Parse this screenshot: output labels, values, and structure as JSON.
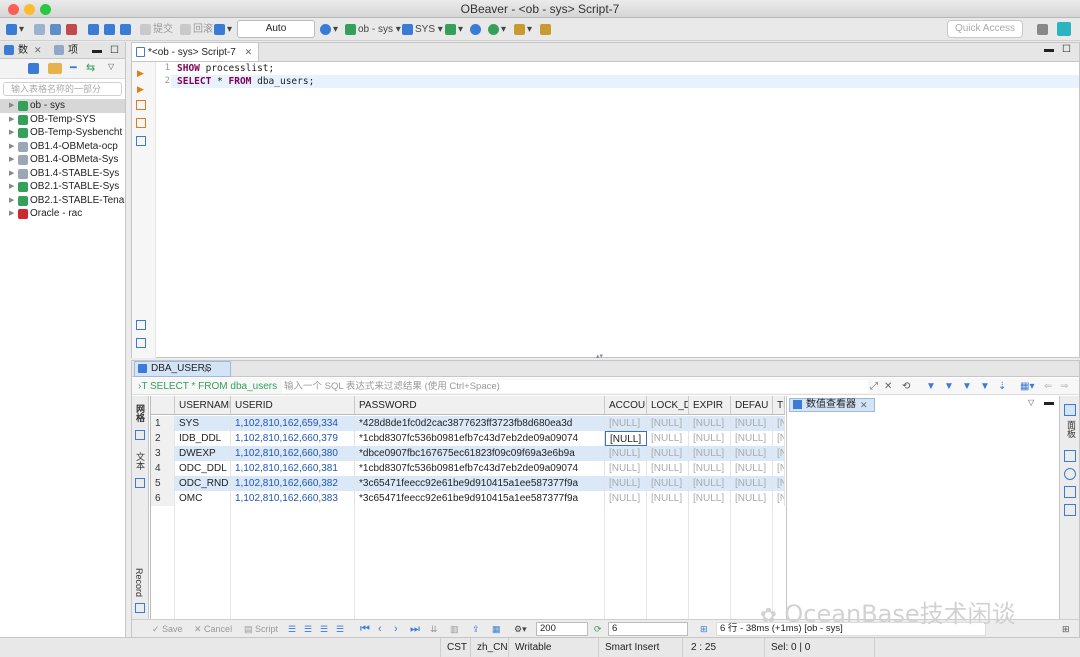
{
  "window": {
    "title": "OBeaver - <ob - sys> Script-7"
  },
  "toolbar": {
    "transaction_mode": "Auto",
    "connection": "ob - sys",
    "schema": "SYS",
    "commit_label": "提交",
    "rollback_label": "回滚",
    "quick_access_placeholder": "Quick Access"
  },
  "navigator": {
    "tab1": "数",
    "tab2": "项",
    "filter_placeholder": "输入表格名称的一部分",
    "items": [
      {
        "label": "ob - sys",
        "color": "#35a05a"
      },
      {
        "label": "OB-Temp-SYS",
        "color": "#35a05a"
      },
      {
        "label": "OB-Temp-Sysbencht",
        "color": "#35a05a"
      },
      {
        "label": "OB1.4-OBMeta-ocp",
        "color": "#9aa7b4"
      },
      {
        "label": "OB1.4-OBMeta-Sys",
        "color": "#9aa7b4"
      },
      {
        "label": "OB1.4-STABLE-Sys",
        "color": "#9aa7b4"
      },
      {
        "label": "OB2.1-STABLE-Sys",
        "color": "#35a05a"
      },
      {
        "label": "OB2.1-STABLE-Tena",
        "color": "#35a05a"
      },
      {
        "label": "Oracle - rac",
        "color": "#d0262d"
      }
    ]
  },
  "editor": {
    "tab_label": "*<ob - sys> Script-7",
    "lines": [
      {
        "num": "1",
        "kw1": "SHOW",
        "rest": " processlist;"
      },
      {
        "num": "2",
        "kw1": "SELECT",
        "mid": " * ",
        "kw2": "FROM",
        "rest": " dba_users;"
      }
    ]
  },
  "results": {
    "tab_label": "DBA_USERS",
    "filter_query": "SELECT * FROM dba_users",
    "filter_placeholder": "输入一个 SQL 表达式来过滤结果 (使用 Ctrl+Space)",
    "side_tab_grid": "网格",
    "side_tab_text": "文本",
    "side_tab_record": "Record",
    "columns": [
      "USERNAME",
      "USERID",
      "PASSWORD",
      "ACCOU",
      "LOCK_D",
      "EXPIR",
      "DEFAU",
      "TE"
    ],
    "rows": [
      {
        "n": "1",
        "username": "SYS",
        "userid": "1,102,810,162,659,334",
        "password": "*428d8de1fc0d2cac3877623ff3723fb8d680ea3d",
        "c4": "[NULL]",
        "c5": "[NULL]",
        "c6": "[NULL]",
        "c7": "[NULL]",
        "c8": "[N"
      },
      {
        "n": "2",
        "username": "IDB_DDL",
        "userid": "1,102,810,162,660,379",
        "password": "*1cbd8307fc536b0981efb7c43d7eb2de09a09074",
        "c4": "[NULL]",
        "c5": "[NULL]",
        "c6": "[NULL]",
        "c7": "[NULL]",
        "c8": "[N"
      },
      {
        "n": "3",
        "username": "DWEXP",
        "userid": "1,102,810,162,660,380",
        "password": "*dbce0907fbc167675ec61823f09c09f69a3e6b9a",
        "c4": "[NULL]",
        "c5": "[NULL]",
        "c6": "[NULL]",
        "c7": "[NULL]",
        "c8": "[N"
      },
      {
        "n": "4",
        "username": "ODC_DDL",
        "userid": "1,102,810,162,660,381",
        "password": "*1cbd8307fc536b0981efb7c43d7eb2de09a09074",
        "c4": "[NULL]",
        "c5": "[NULL]",
        "c6": "[NULL]",
        "c7": "[NULL]",
        "c8": "[N"
      },
      {
        "n": "5",
        "username": "ODC_RND",
        "userid": "1,102,810,162,660,382",
        "password": "*3c65471feecc92e61be9d910415a1ee587377f9a",
        "c4": "[NULL]",
        "c5": "[NULL]",
        "c6": "[NULL]",
        "c7": "[NULL]",
        "c8": "[N"
      },
      {
        "n": "6",
        "username": "OMC",
        "userid": "1,102,810,162,660,383",
        "password": "*3c65471feecc92e61be9d910415a1ee587377f9a",
        "c4": "[NULL]",
        "c5": "[NULL]",
        "c6": "[NULL]",
        "c7": "[NULL]",
        "c8": "[N"
      }
    ],
    "viewer_tab": "数值查看器",
    "viewer_side_label": "面板"
  },
  "bottombar": {
    "save": "Save",
    "cancel": "Cancel",
    "script": "Script",
    "fetch_size": "200",
    "row_count": "6",
    "summary": "6 行 - 38ms (+1ms) [ob - sys]"
  },
  "statusbar": {
    "timezone": "CST",
    "locale": "zh_CN",
    "mode": "Writable",
    "insert": "Smart Insert",
    "position": "2 : 25",
    "selection": "Sel: 0 | 0"
  },
  "watermark": "OceanBase技术闲谈"
}
